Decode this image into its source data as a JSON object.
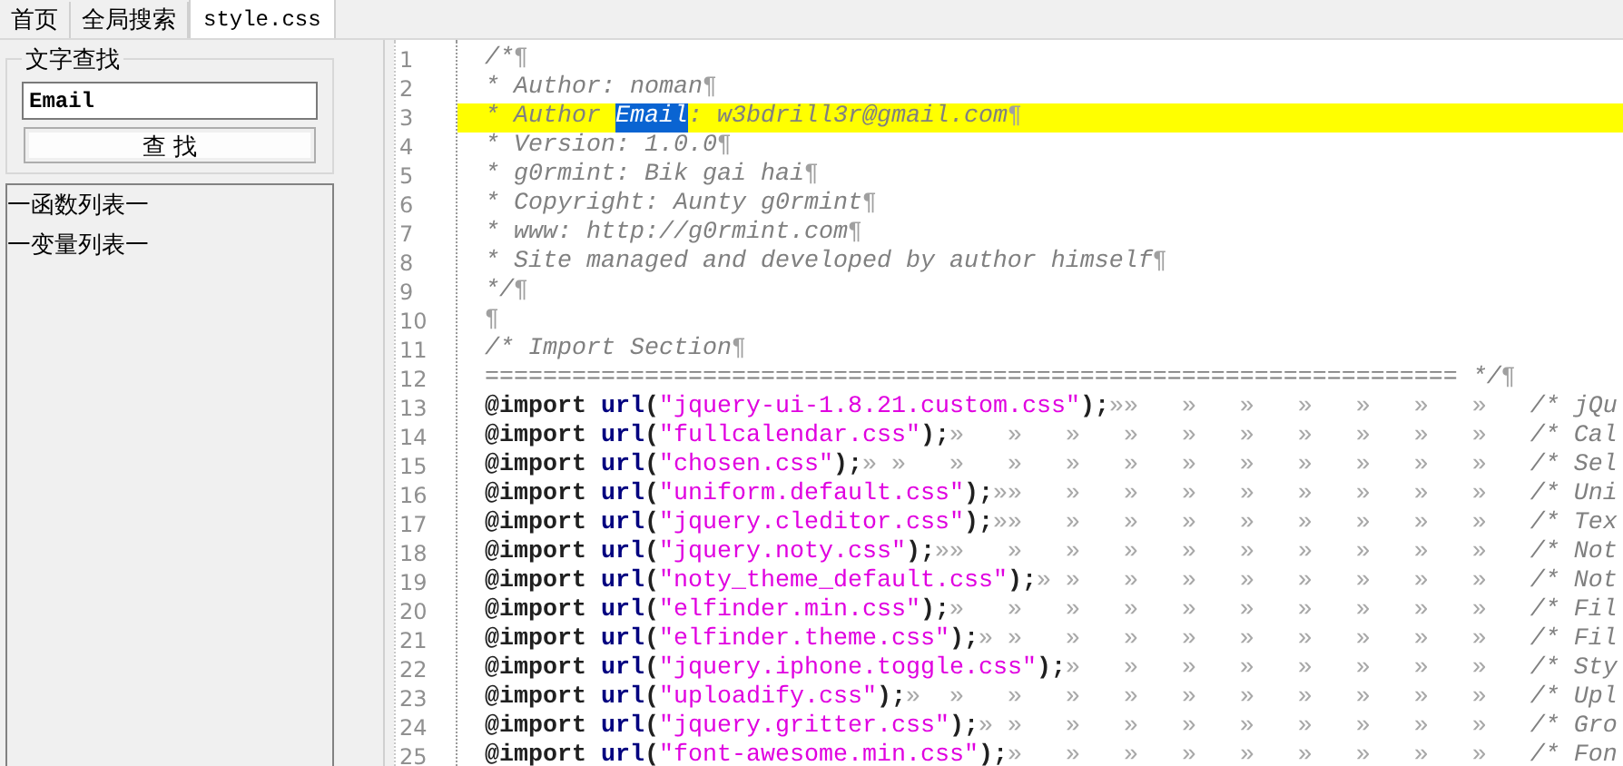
{
  "tabs": [
    {
      "label": "首页",
      "selected": false
    },
    {
      "label": "全局搜索",
      "selected": false
    },
    {
      "label": "style.css",
      "selected": true
    }
  ],
  "search_panel": {
    "title": "文字查找",
    "value": "Email",
    "button": "查 找"
  },
  "outline": [
    {
      "label": "一函数列表一"
    },
    {
      "label": "一变量列表一"
    }
  ],
  "editor": {
    "lines": [
      {
        "number": "1",
        "highlighted": false,
        "segments": [
          {
            "kind": "comment",
            "text": "/*"
          },
          {
            "kind": "eol",
            "text": "¶"
          }
        ]
      },
      {
        "number": "2",
        "highlighted": false,
        "segments": [
          {
            "kind": "comment",
            "text": "* Author: noman"
          },
          {
            "kind": "eol",
            "text": "¶"
          }
        ]
      },
      {
        "number": "3",
        "highlighted": true,
        "segments": [
          {
            "kind": "comment",
            "text": "* Author "
          },
          {
            "kind": "selection",
            "text": "Email"
          },
          {
            "kind": "comment",
            "text": ": w3bdrill3r@gmail.com"
          },
          {
            "kind": "eol",
            "text": "¶"
          }
        ]
      },
      {
        "number": "4",
        "highlighted": false,
        "segments": [
          {
            "kind": "comment",
            "text": "* Version: 1.0.0"
          },
          {
            "kind": "eol",
            "text": "¶"
          }
        ]
      },
      {
        "number": "5",
        "highlighted": false,
        "segments": [
          {
            "kind": "comment",
            "text": "* g0rmint: Bik gai hai"
          },
          {
            "kind": "eol",
            "text": "¶"
          }
        ]
      },
      {
        "number": "6",
        "highlighted": false,
        "segments": [
          {
            "kind": "comment",
            "text": "* Copyright: Aunty g0rmint"
          },
          {
            "kind": "eol",
            "text": "¶"
          }
        ]
      },
      {
        "number": "7",
        "highlighted": false,
        "segments": [
          {
            "kind": "comment",
            "text": "* www: http://g0rmint.com"
          },
          {
            "kind": "eol",
            "text": "¶"
          }
        ]
      },
      {
        "number": "8",
        "highlighted": false,
        "segments": [
          {
            "kind": "comment",
            "text": "* Site managed and developed by author himself"
          },
          {
            "kind": "eol",
            "text": "¶"
          }
        ]
      },
      {
        "number": "9",
        "highlighted": false,
        "segments": [
          {
            "kind": "comment",
            "text": "*/"
          },
          {
            "kind": "eol",
            "text": "¶"
          }
        ]
      },
      {
        "number": "10",
        "highlighted": false,
        "segments": [
          {
            "kind": "eol",
            "text": "¶"
          }
        ]
      },
      {
        "number": "11",
        "highlighted": false,
        "segments": [
          {
            "kind": "comment",
            "text": "/* Import Section"
          },
          {
            "kind": "eol",
            "text": "¶"
          }
        ]
      },
      {
        "number": "12",
        "highlighted": false,
        "segments": [
          {
            "kind": "comment",
            "text": "=================================================================== */"
          },
          {
            "kind": "eol",
            "text": "¶"
          }
        ]
      },
      {
        "number": "13",
        "highlighted": false,
        "segments": [
          {
            "kind": "keyword",
            "text": "@import "
          },
          {
            "kind": "function",
            "text": "url"
          },
          {
            "kind": "punct",
            "text": "("
          },
          {
            "kind": "string",
            "text": "\"jquery-ui-1.8.21.custom.css\""
          },
          {
            "kind": "punct",
            "text": ");"
          },
          {
            "kind": "ws",
            "text": "»»   »   »   »   »   »   »   "
          },
          {
            "kind": "comment",
            "text": "/* jQu"
          }
        ]
      },
      {
        "number": "14",
        "highlighted": false,
        "segments": [
          {
            "kind": "keyword",
            "text": "@import "
          },
          {
            "kind": "function",
            "text": "url"
          },
          {
            "kind": "punct",
            "text": "("
          },
          {
            "kind": "string",
            "text": "\"fullcalendar.css\""
          },
          {
            "kind": "punct",
            "text": ");"
          },
          {
            "kind": "ws",
            "text": "»   »   »   »   »   »   »   »   »   »   "
          },
          {
            "kind": "comment",
            "text": "/* Cal"
          }
        ]
      },
      {
        "number": "15",
        "highlighted": false,
        "segments": [
          {
            "kind": "keyword",
            "text": "@import "
          },
          {
            "kind": "function",
            "text": "url"
          },
          {
            "kind": "punct",
            "text": "("
          },
          {
            "kind": "string",
            "text": "\"chosen.css\""
          },
          {
            "kind": "punct",
            "text": ");"
          },
          {
            "kind": "ws",
            "text": "» »   »   »   »   »   »   »   »   »   »   »   "
          },
          {
            "kind": "comment",
            "text": "/* Sel"
          }
        ]
      },
      {
        "number": "16",
        "highlighted": false,
        "segments": [
          {
            "kind": "keyword",
            "text": "@import "
          },
          {
            "kind": "function",
            "text": "url"
          },
          {
            "kind": "punct",
            "text": "("
          },
          {
            "kind": "string",
            "text": "\"uniform.default.css\""
          },
          {
            "kind": "punct",
            "text": ");"
          },
          {
            "kind": "ws",
            "text": "»»   »   »   »   »   »   »   »   »   "
          },
          {
            "kind": "comment",
            "text": "/* Uni"
          }
        ]
      },
      {
        "number": "17",
        "highlighted": false,
        "segments": [
          {
            "kind": "keyword",
            "text": "@import "
          },
          {
            "kind": "function",
            "text": "url"
          },
          {
            "kind": "punct",
            "text": "("
          },
          {
            "kind": "string",
            "text": "\"jquery.cleditor.css\""
          },
          {
            "kind": "punct",
            "text": ");"
          },
          {
            "kind": "ws",
            "text": "»»   »   »   »   »   »   »   »   »   "
          },
          {
            "kind": "comment",
            "text": "/* Tex"
          }
        ]
      },
      {
        "number": "18",
        "highlighted": false,
        "segments": [
          {
            "kind": "keyword",
            "text": "@import "
          },
          {
            "kind": "function",
            "text": "url"
          },
          {
            "kind": "punct",
            "text": "("
          },
          {
            "kind": "string",
            "text": "\"jquery.noty.css\""
          },
          {
            "kind": "punct",
            "text": ");"
          },
          {
            "kind": "ws",
            "text": "»»   »   »   »   »   »   »   »   »   »   "
          },
          {
            "kind": "comment",
            "text": "/* Not"
          }
        ]
      },
      {
        "number": "19",
        "highlighted": false,
        "segments": [
          {
            "kind": "keyword",
            "text": "@import "
          },
          {
            "kind": "function",
            "text": "url"
          },
          {
            "kind": "punct",
            "text": "("
          },
          {
            "kind": "string",
            "text": "\"noty_theme_default.css\""
          },
          {
            "kind": "punct",
            "text": ");"
          },
          {
            "kind": "ws",
            "text": "» »   »   »   »   »   »   »   »   "
          },
          {
            "kind": "comment",
            "text": "/* Not"
          }
        ]
      },
      {
        "number": "20",
        "highlighted": false,
        "segments": [
          {
            "kind": "keyword",
            "text": "@import "
          },
          {
            "kind": "function",
            "text": "url"
          },
          {
            "kind": "punct",
            "text": "("
          },
          {
            "kind": "string",
            "text": "\"elfinder.min.css\""
          },
          {
            "kind": "punct",
            "text": ");"
          },
          {
            "kind": "ws",
            "text": "»   »   »   »   »   »   »   »   »   »   "
          },
          {
            "kind": "comment",
            "text": "/* Fil"
          }
        ]
      },
      {
        "number": "21",
        "highlighted": false,
        "segments": [
          {
            "kind": "keyword",
            "text": "@import "
          },
          {
            "kind": "function",
            "text": "url"
          },
          {
            "kind": "punct",
            "text": "("
          },
          {
            "kind": "string",
            "text": "\"elfinder.theme.css\""
          },
          {
            "kind": "punct",
            "text": ");"
          },
          {
            "kind": "ws",
            "text": "» »   »   »   »   »   »   »   »   »   "
          },
          {
            "kind": "comment",
            "text": "/* Fil"
          }
        ]
      },
      {
        "number": "22",
        "highlighted": false,
        "segments": [
          {
            "kind": "keyword",
            "text": "@import "
          },
          {
            "kind": "function",
            "text": "url"
          },
          {
            "kind": "punct",
            "text": "("
          },
          {
            "kind": "string",
            "text": "\"jquery.iphone.toggle.css\""
          },
          {
            "kind": "punct",
            "text": ");"
          },
          {
            "kind": "ws",
            "text": "»   »   »   »   »   »   »   »   "
          },
          {
            "kind": "comment",
            "text": "/* Sty"
          }
        ]
      },
      {
        "number": "23",
        "highlighted": false,
        "segments": [
          {
            "kind": "keyword",
            "text": "@import "
          },
          {
            "kind": "function",
            "text": "url"
          },
          {
            "kind": "punct",
            "text": "("
          },
          {
            "kind": "string",
            "text": "\"uploadify.css\""
          },
          {
            "kind": "punct",
            "text": ");"
          },
          {
            "kind": "ws",
            "text": "»  »   »   »   »   »   »   »   »   »   »   "
          },
          {
            "kind": "comment",
            "text": "/* Upl"
          }
        ]
      },
      {
        "number": "24",
        "highlighted": false,
        "segments": [
          {
            "kind": "keyword",
            "text": "@import "
          },
          {
            "kind": "function",
            "text": "url"
          },
          {
            "kind": "punct",
            "text": "("
          },
          {
            "kind": "string",
            "text": "\"jquery.gritter.css\""
          },
          {
            "kind": "punct",
            "text": ");"
          },
          {
            "kind": "ws",
            "text": "» »   »   »   »   »   »   »   »   »   "
          },
          {
            "kind": "comment",
            "text": "/* Gro"
          }
        ]
      },
      {
        "number": "25",
        "highlighted": false,
        "segments": [
          {
            "kind": "keyword",
            "text": "@import "
          },
          {
            "kind": "function",
            "text": "url"
          },
          {
            "kind": "punct",
            "text": "("
          },
          {
            "kind": "string",
            "text": "\"font-awesome.min.css\""
          },
          {
            "kind": "punct",
            "text": ");"
          },
          {
            "kind": "ws",
            "text": "»   »   »   »   »   »   »   »   »   "
          },
          {
            "kind": "comment",
            "text": "/* Fon"
          }
        ]
      }
    ]
  }
}
